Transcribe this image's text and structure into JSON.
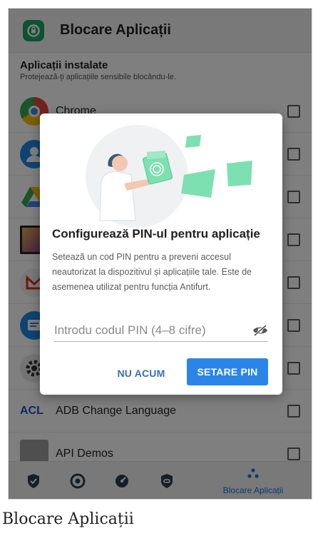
{
  "appbar": {
    "title": "Blocare Aplicații"
  },
  "section": {
    "title": "Aplicații instalate",
    "subtitle": "Protejează-ți aplicațiile sensibile blocându-le."
  },
  "apps": [
    {
      "label": "Chrome",
      "icon": "chrome-icon"
    },
    {
      "label": "",
      "icon": "contacts-icon"
    },
    {
      "label": "",
      "icon": "drive-icon"
    },
    {
      "label": "",
      "icon": "gallery-icon"
    },
    {
      "label": "",
      "icon": "gmail-icon"
    },
    {
      "label": "",
      "icon": "messages-icon"
    },
    {
      "label": "",
      "icon": "settings-icon"
    },
    {
      "label": "ADB Change Language",
      "icon_text": "ACL"
    },
    {
      "label": "API Demos",
      "icon": "folder-icon"
    }
  ],
  "bottom_nav": {
    "active_label": "Blocare Aplicații",
    "items": [
      "shield-icon",
      "target-icon",
      "speed-icon",
      "link-shield-icon",
      "apps-lock-icon"
    ]
  },
  "dialog": {
    "title": "Configurează PIN-ul pentru aplicație",
    "body": "Setează un cod PIN pentru a preveni accesul neautorizat la dispozitivul și aplicațiile tale. Este de asemenea utilizat pentru funcția Antifurt.",
    "pin_placeholder": "Introdu codul PIN (4–8 cifre)",
    "secondary_button": "NU ACUM",
    "primary_button": "SETARE PIN"
  },
  "caption": "Blocare Aplicații",
  "colors": {
    "accent": "#2b85e8",
    "brand": "#19a566",
    "illustration": "#7de0b0"
  }
}
